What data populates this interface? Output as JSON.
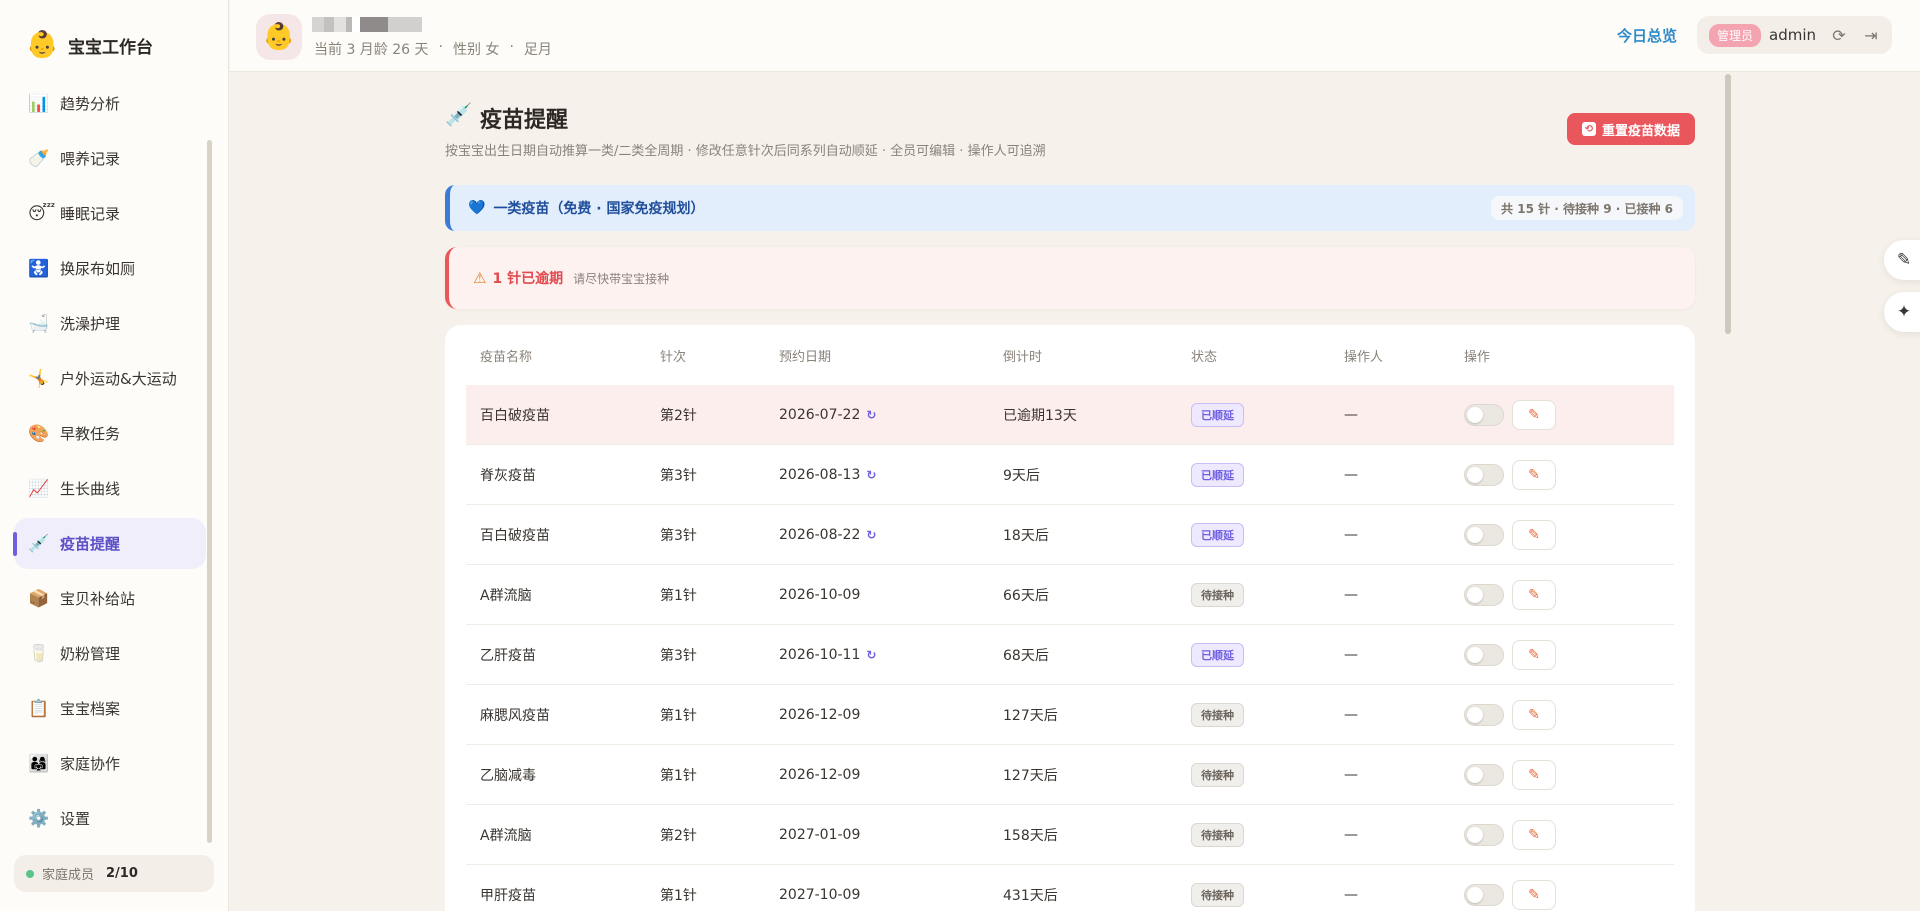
{
  "app": {
    "logo": "👶",
    "title": "宝宝工作台"
  },
  "sidebar": {
    "items": [
      {
        "icon": "📊",
        "label": "趋势分析"
      },
      {
        "icon": "🍼",
        "label": "喂养记录"
      },
      {
        "icon": "😴",
        "label": "睡眠记录"
      },
      {
        "icon": "🚼",
        "label": "换尿布如厕"
      },
      {
        "icon": "🛁",
        "label": "洗澡护理"
      },
      {
        "icon": "🤸",
        "label": "户外运动&大运动"
      },
      {
        "icon": "🎨",
        "label": "早教任务"
      },
      {
        "icon": "📈",
        "label": "生长曲线"
      },
      {
        "icon": "💉",
        "label": "疫苗提醒"
      },
      {
        "icon": "📦",
        "label": "宝贝补给站"
      },
      {
        "icon": "🥛",
        "label": "奶粉管理"
      },
      {
        "icon": "📋",
        "label": "宝宝档案"
      },
      {
        "icon": "👨‍👩‍👧",
        "label": "家庭协作"
      },
      {
        "icon": "⚙️",
        "label": "设置"
      }
    ],
    "active_index": 8,
    "members_label": "家庭成员",
    "members_count": "2/10"
  },
  "header": {
    "baby_avatar": "👶",
    "age": "当前 3 月龄 26 天",
    "sep": "·",
    "gender": "性别 女",
    "term": "足月",
    "today_link": "今日总览",
    "role_badge": "管理员",
    "username": "admin"
  },
  "page": {
    "icon": "💉",
    "title": "疫苗提醒",
    "description": "按宝宝出生日期自动推算一类/二类全周期 · 修改任意针次后同系列自动顺延 · 全员可编辑 · 操作人可追溯",
    "reset_button": "重置疫苗数据"
  },
  "section": {
    "icon": "💙",
    "title": "一类疫苗（免费 · 国家免疫规划）",
    "stats": "共 15 针 · 待接种 9 · 已接种 6"
  },
  "alert": {
    "icon": "⚠",
    "title": "1 针已逾期",
    "subtitle": "请尽快带宝宝接种"
  },
  "table": {
    "headers": [
      "疫苗名称",
      "针次",
      "预约日期",
      "倒计时",
      "状态",
      "操作人",
      "操作"
    ],
    "rows": [
      {
        "name": "百白破疫苗",
        "dose": "第2针",
        "date": "2026-07-22",
        "rescheduled": true,
        "countdown": "已逾期13天",
        "status": "已顺延",
        "status_type": "postponed",
        "operator": "—",
        "overdue": true
      },
      {
        "name": "脊灰疫苗",
        "dose": "第3针",
        "date": "2026-08-13",
        "rescheduled": true,
        "countdown": "9天后",
        "status": "已顺延",
        "status_type": "postponed",
        "operator": "—",
        "overdue": false
      },
      {
        "name": "百白破疫苗",
        "dose": "第3针",
        "date": "2026-08-22",
        "rescheduled": true,
        "countdown": "18天后",
        "status": "已顺延",
        "status_type": "postponed",
        "operator": "—",
        "overdue": false
      },
      {
        "name": "A群流脑",
        "dose": "第1针",
        "date": "2026-10-09",
        "rescheduled": false,
        "countdown": "66天后",
        "status": "待接种",
        "status_type": "pending",
        "operator": "—",
        "overdue": false
      },
      {
        "name": "乙肝疫苗",
        "dose": "第3针",
        "date": "2026-10-11",
        "rescheduled": true,
        "countdown": "68天后",
        "status": "已顺延",
        "status_type": "postponed",
        "operator": "—",
        "overdue": false
      },
      {
        "name": "麻腮风疫苗",
        "dose": "第1针",
        "date": "2026-12-09",
        "rescheduled": false,
        "countdown": "127天后",
        "status": "待接种",
        "status_type": "pending",
        "operator": "—",
        "overdue": false
      },
      {
        "name": "乙脑减毒",
        "dose": "第1针",
        "date": "2026-12-09",
        "rescheduled": false,
        "countdown": "127天后",
        "status": "待接种",
        "status_type": "pending",
        "operator": "—",
        "overdue": false
      },
      {
        "name": "A群流脑",
        "dose": "第2针",
        "date": "2027-01-09",
        "rescheduled": false,
        "countdown": "158天后",
        "status": "待接种",
        "status_type": "pending",
        "operator": "—",
        "overdue": false
      },
      {
        "name": "甲肝疫苗",
        "dose": "第1针",
        "date": "2027-10-09",
        "rescheduled": false,
        "countdown": "431天后",
        "status": "待接种",
        "status_type": "pending",
        "operator": "—",
        "overdue": false
      }
    ]
  },
  "icons": {
    "reschedule": "↻",
    "refresh": "⟳",
    "logout": "⇥",
    "edit": "✎",
    "reset": "⟲",
    "float_top": "✎",
    "float_bottom": "✦"
  },
  "colors": {
    "accent": "#6d5fe0",
    "danger": "#e9575d",
    "link": "#2f8ac9",
    "section": "#3a7bd5"
  }
}
